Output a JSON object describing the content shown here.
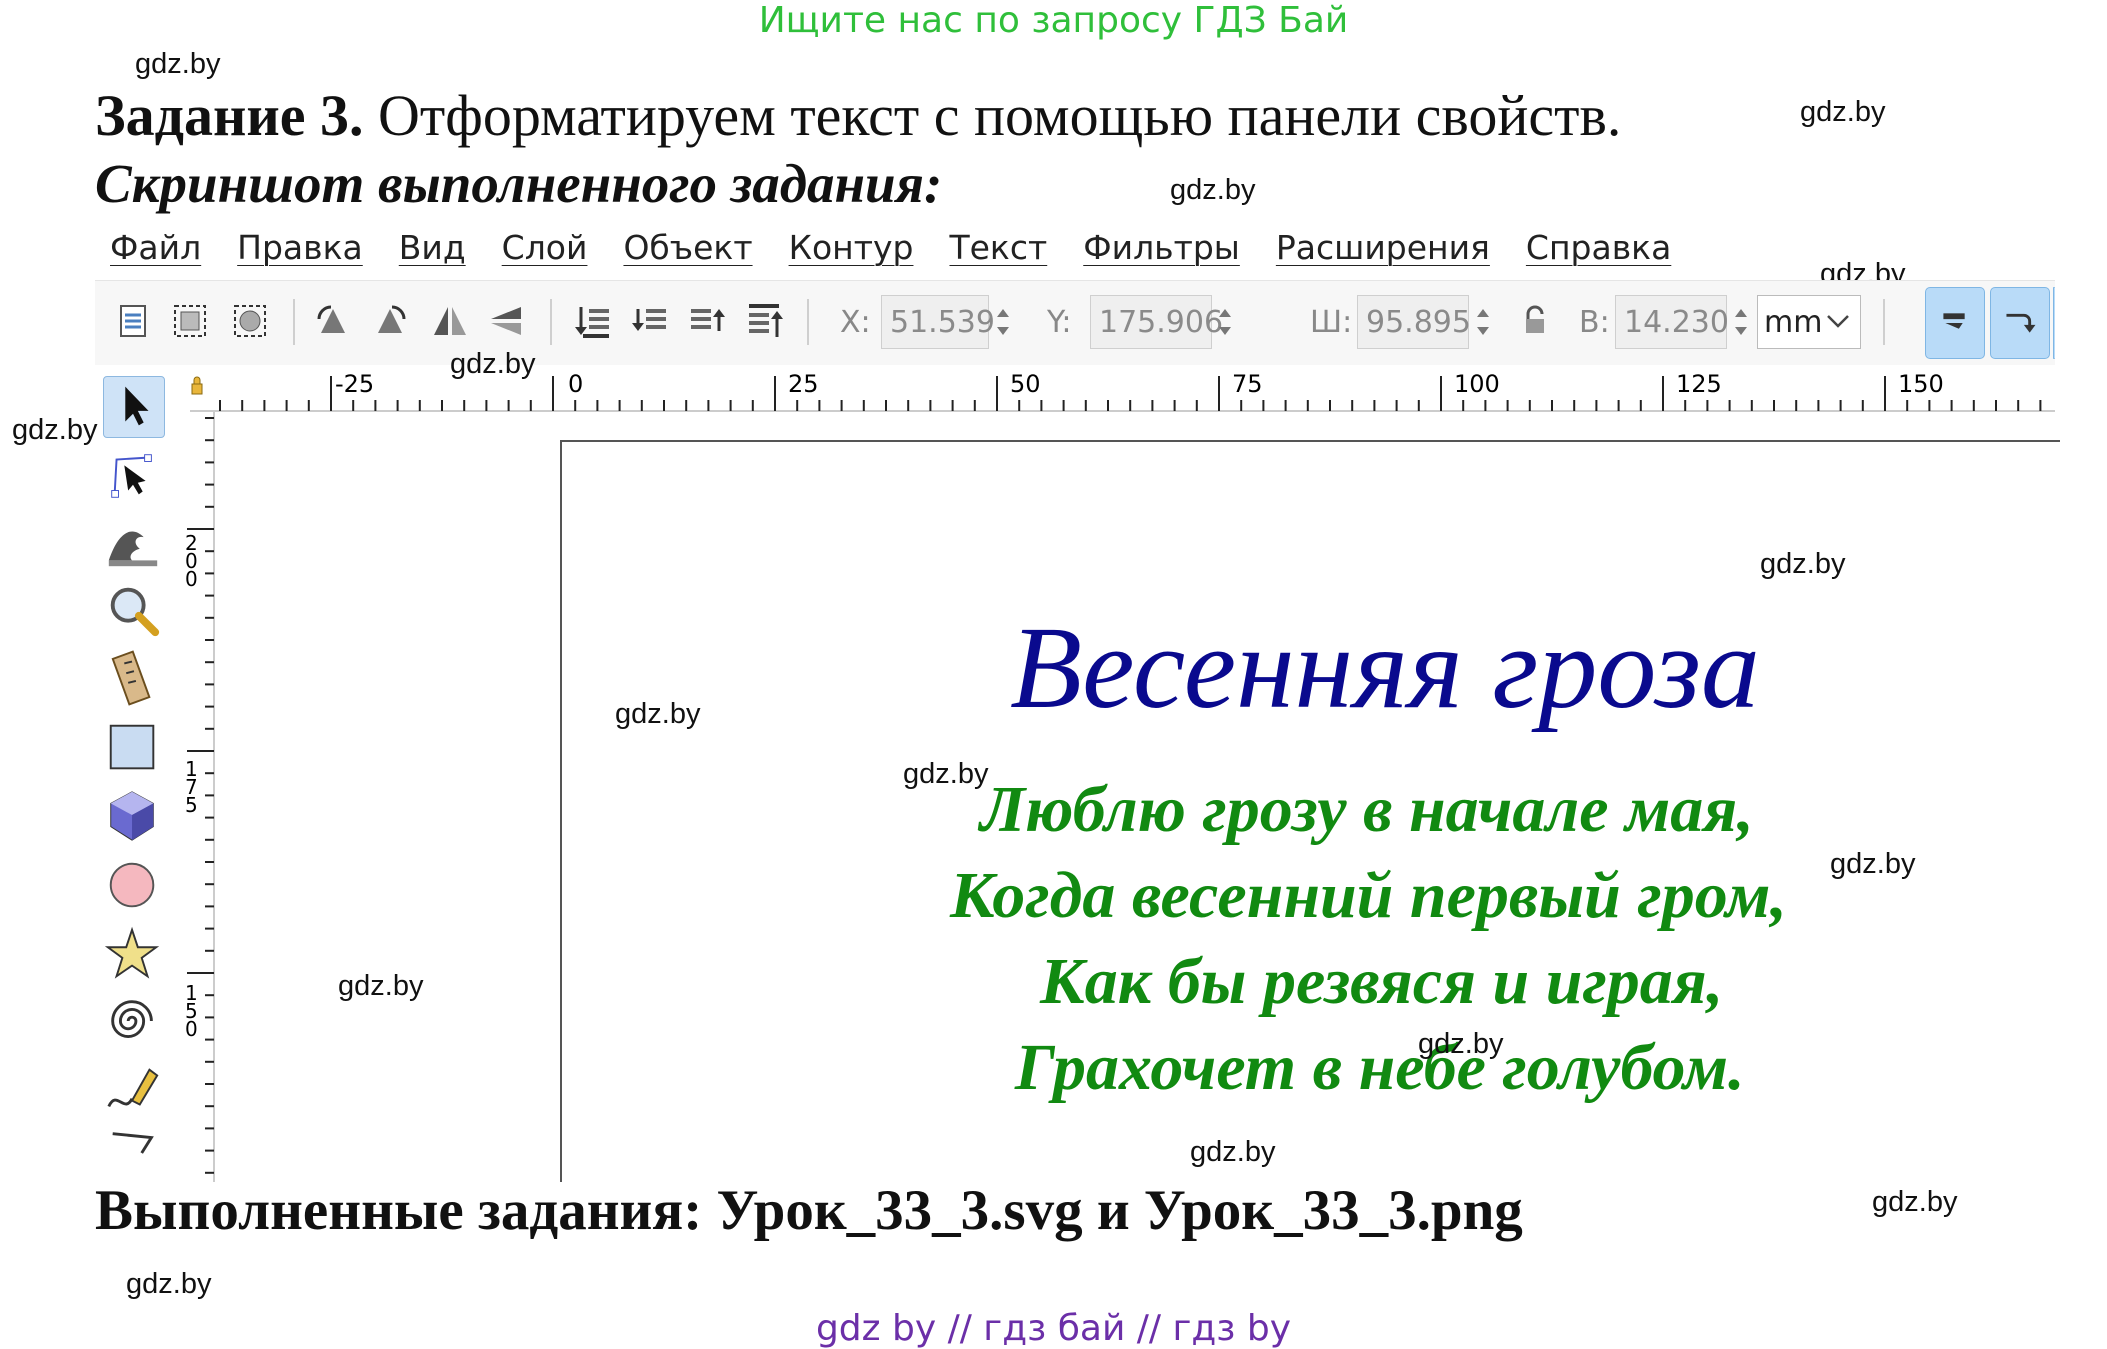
{
  "top_banner": "Ищите нас по запросу ГДЗ Бай",
  "task": {
    "label": "Задание 3.",
    "text": " Отформатируем текст с помощью панели свойств.",
    "subtitle": "Скриншот выполненного задания:"
  },
  "menu": [
    "Файл",
    "Правка",
    "Вид",
    "Слой",
    "Объект",
    "Контур",
    "Текст",
    "Фильтры",
    "Расширения",
    "Справка"
  ],
  "toolbar": {
    "x_label": "X:",
    "x_value": "51.539",
    "y_label": "Y:",
    "y_value": "175.906",
    "w_label": "Ш:",
    "w_value": "95.895",
    "h_label": "В:",
    "h_value": "14.230",
    "unit": "mm"
  },
  "ruler_h": [
    "-25",
    "0",
    "25",
    "50",
    "75",
    "100",
    "125",
    "150"
  ],
  "ruler_v": [
    "200",
    "175",
    "150"
  ],
  "poem": {
    "title": "Весенняя гроза",
    "lines": [
      "Люблю грозу в начале мая,",
      "Когда весенний первый гром,",
      "Как бы резвяся и играя,",
      "Грахочет в небе голубом."
    ]
  },
  "footer": "Выполненные задания: Урок_33_3.svg и Урок_33_3.png",
  "watermark": "gdz.by",
  "bottom_banner": "gdz by  //  гдз бай  //  гдз by",
  "colors": {
    "title_blue": "#0a0a8e",
    "poem_green": "#118a11",
    "banner_green": "#2fbf3a",
    "banner_purple": "#6b2fa8"
  }
}
